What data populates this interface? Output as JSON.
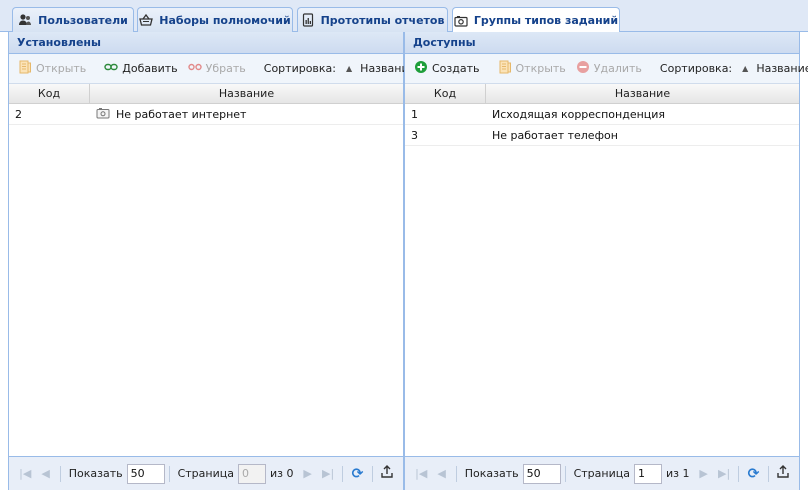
{
  "tabs": [
    {
      "label": "Пользователи",
      "icon": "users-icon",
      "active": false
    },
    {
      "label": "Наборы полномочий",
      "icon": "basket-icon",
      "active": false
    },
    {
      "label": "Прототипы отчетов",
      "icon": "report-icon",
      "active": false
    },
    {
      "label": "Группы типов заданий",
      "icon": "camera-folder-icon",
      "active": true
    }
  ],
  "left": {
    "title": "Установлены",
    "toolbar": {
      "open": "Открыть",
      "add": "Добавить",
      "remove": "Убрать",
      "sort_label": "Сортировка:",
      "sort_value": "Название"
    },
    "columns": {
      "code": "Код",
      "name": "Название"
    },
    "rows": [
      {
        "code": "2",
        "name": "Не работает интернет"
      }
    ],
    "pager": {
      "show_label": "Показать",
      "page_size": "50",
      "page_label": "Страница",
      "page": "0",
      "of_label": "из 0"
    }
  },
  "right": {
    "title": "Доступны",
    "toolbar": {
      "create": "Создать",
      "open": "Открыть",
      "delete": "Удалить",
      "sort_label": "Сортировка:",
      "sort_value": "Название"
    },
    "columns": {
      "code": "Код",
      "name": "Название"
    },
    "rows": [
      {
        "code": "1",
        "name": "Исходящая корреспонденция"
      },
      {
        "code": "3",
        "name": "Не работает телефон"
      }
    ],
    "pager": {
      "show_label": "Показать",
      "page_size": "50",
      "page_label": "Страница",
      "page": "1",
      "of_label": "из 1"
    }
  },
  "colors": {
    "accent": "#15428b",
    "border": "#99bbe8",
    "create_green": "#1e9e3a",
    "delete_red": "#d9534f"
  }
}
